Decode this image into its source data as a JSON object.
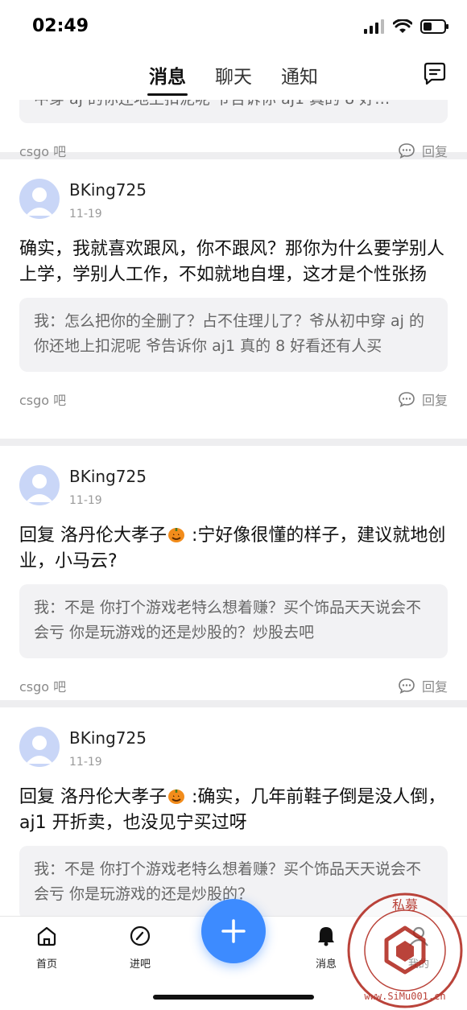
{
  "status_bar": {
    "time": "02:49"
  },
  "tabs": [
    {
      "label": "消息",
      "active": true
    },
    {
      "label": "聊天",
      "active": false
    },
    {
      "label": "通知",
      "active": false
    }
  ],
  "partial_card": {
    "quote": "中穿 aj 的你还地上扣泥呢 爷告诉你 aj1 真的 8 好…",
    "forum": "csgo 吧",
    "reply_label": "回复"
  },
  "posts": [
    {
      "username": "BKing725",
      "date": "11-19",
      "body_prefix": "",
      "body": "确实，我就喜欢跟风，你不跟风？那你为什么要学别人上学，学别人工作，不如就地自埋，这才是个性张扬",
      "quote": "我：怎么把你的全删了？占不住理儿了？爷从初中穿 aj 的你还地上扣泥呢 爷告诉你 aj1 真的 8 好看还有人买",
      "forum": "csgo 吧",
      "reply_label": "回复"
    },
    {
      "username": "BKing725",
      "date": "11-19",
      "body_prefix": "回复 洛丹伦大孝子",
      "body": " :宁好像很懂的样子，建议就地创业，小马云?",
      "quote": "我：不是 你打个游戏老特么想着赚？买个饰品天天说会不会亏 你是玩游戏的还是炒股的？炒股去吧",
      "forum": "csgo 吧",
      "reply_label": "回复"
    },
    {
      "username": "BKing725",
      "date": "11-19",
      "body_prefix": "回复 洛丹伦大孝子",
      "body": " :确实，几年前鞋子倒是没人倒，aj1 开折卖，也没见宁买过呀",
      "quote": "我：不是 你打个游戏老特么想着赚？买个饰品天天说会不会亏 你是玩游戏的还是炒股的？",
      "forum": "csgo 吧",
      "reply_label": "回复"
    }
  ],
  "bottom_nav": {
    "home": "首页",
    "forum": "进吧",
    "messages": "消息",
    "me": "我的"
  },
  "watermark": {
    "top_text": "私募",
    "url": "www.SiMu001.cn"
  },
  "colors": {
    "accent": "#3d8bff",
    "avatar": "#c9d6f7",
    "quote_bg": "#f2f2f4"
  }
}
